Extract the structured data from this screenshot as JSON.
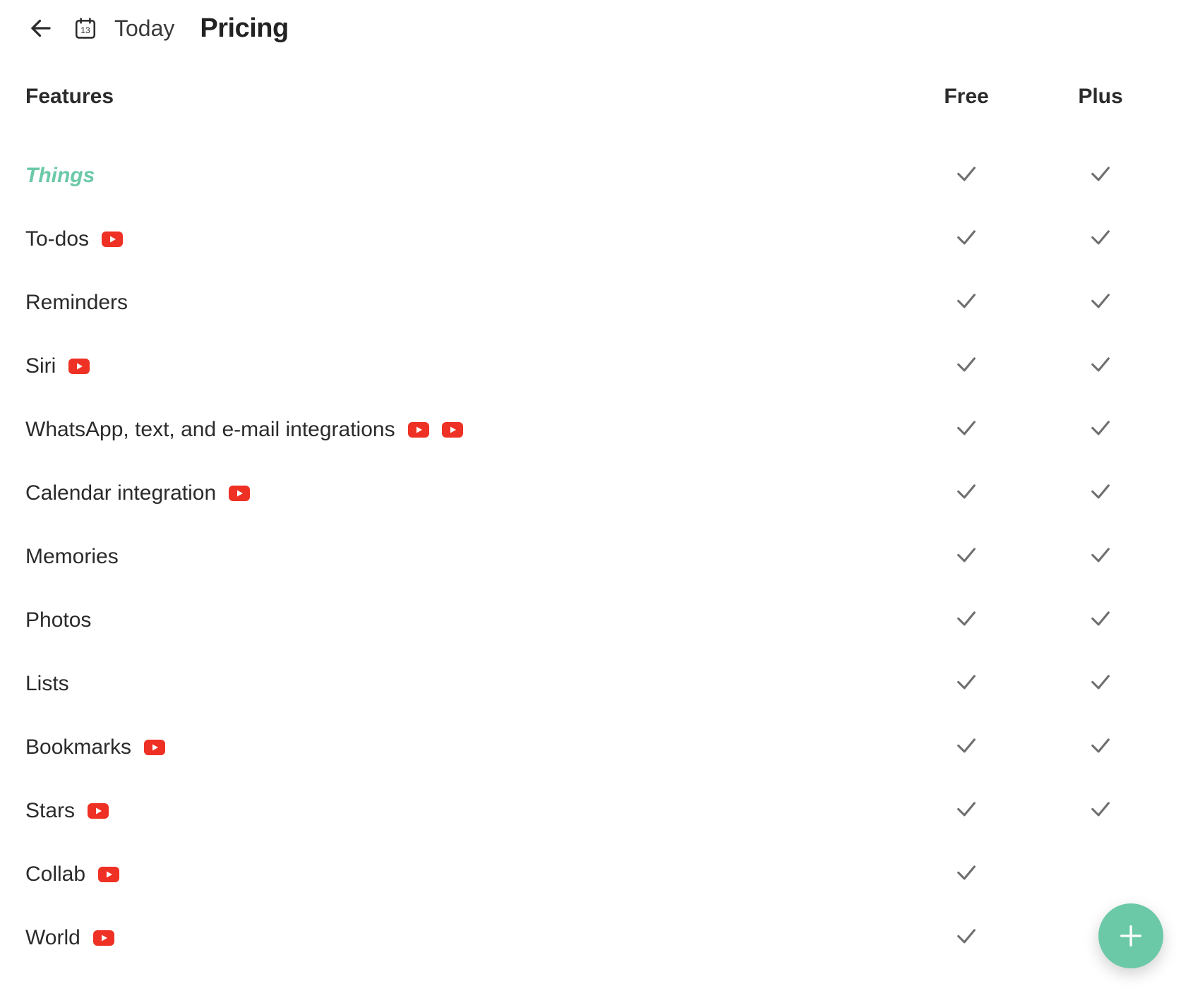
{
  "header": {
    "back_icon": "arrow-left-icon",
    "calendar_day": "13",
    "today_label": "Today",
    "page_title": "Pricing"
  },
  "table": {
    "columns": {
      "features": "Features",
      "free": "Free",
      "plus": "Plus"
    },
    "rows": [
      {
        "label": "Things",
        "style": "things",
        "videos": 0,
        "free": true,
        "plus": true
      },
      {
        "label": "To-dos",
        "videos": 1,
        "free": true,
        "plus": true
      },
      {
        "label": "Reminders",
        "videos": 0,
        "free": true,
        "plus": true
      },
      {
        "label": "Siri",
        "videos": 1,
        "free": true,
        "plus": true
      },
      {
        "label": "WhatsApp, text, and e-mail integrations",
        "videos": 2,
        "free": true,
        "plus": true
      },
      {
        "label": "Calendar integration",
        "videos": 1,
        "free": true,
        "plus": true
      },
      {
        "label": "Memories",
        "videos": 0,
        "free": true,
        "plus": true
      },
      {
        "label": "Photos",
        "videos": 0,
        "free": true,
        "plus": true
      },
      {
        "label": "Lists",
        "videos": 0,
        "free": true,
        "plus": true
      },
      {
        "label": "Bookmarks",
        "videos": 1,
        "free": true,
        "plus": true
      },
      {
        "label": "Stars",
        "videos": 1,
        "free": true,
        "plus": true
      },
      {
        "label": "Collab",
        "videos": 1,
        "free": true,
        "plus": null
      },
      {
        "label": "World",
        "videos": 1,
        "free": true,
        "plus": null
      }
    ]
  },
  "fab": {
    "icon": "plus-icon"
  },
  "colors": {
    "accent": "#6bc9a7",
    "youtube": "#ee3124",
    "text": "#2b2b2b",
    "check": "#6f6f6f"
  }
}
